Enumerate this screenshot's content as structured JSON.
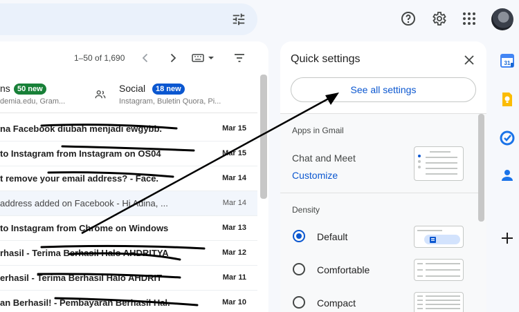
{
  "search": {
    "tune_icon": "tune-icon"
  },
  "header": {
    "help_icon": "help-icon",
    "settings_icon": "gear-icon",
    "apps_icon": "apps-grid-icon",
    "avatar": "avatar"
  },
  "toolbar": {
    "count": "1–50 of 1,690"
  },
  "tabs": [
    {
      "name": "Promotions",
      "label": "ns",
      "badge": "50 new",
      "badge_color": "#188038",
      "sub": "demia.edu, Gram..."
    },
    {
      "name": "Social",
      "label": "Social",
      "badge": "18 new",
      "badge_color": "#0b57d0",
      "sub": "Instagram, Buletin Quora, Pi..."
    }
  ],
  "emails": [
    {
      "text": "na Facebook diubah menjadi ewgybb.",
      "date": "Mar 15",
      "read": false
    },
    {
      "text": "to Instagram from Instagram on OS04",
      "date": "Mar 15",
      "read": false
    },
    {
      "text": "t remove your email address? - Face.",
      "date": "Mar 14",
      "read": false
    },
    {
      "text": "address added on Facebook - Hi Adina, ...",
      "date": "Mar 14",
      "read": true
    },
    {
      "text": "to Instagram from Chrome on Windows",
      "date": "Mar 13",
      "read": false
    },
    {
      "text": "rhasil - Terima Berhasil Halo AHDRITYA",
      "date": "Mar 12",
      "read": false
    },
    {
      "text": "erhasil - Terima Berhasil Halo AHDRIT",
      "date": "Mar 11",
      "read": false
    },
    {
      "text": "an Berhasil! - Pembayaran Berhasil Hal.",
      "date": "Mar 10",
      "read": false
    }
  ],
  "quick_settings": {
    "title": "Quick settings",
    "see_all": "See all settings",
    "apps_heading": "Apps in Gmail",
    "chat_meet": "Chat and Meet",
    "customize": "Customize",
    "density_heading": "Density",
    "density_options": [
      {
        "label": "Default",
        "selected": true
      },
      {
        "label": "Comfortable",
        "selected": false
      },
      {
        "label": "Compact",
        "selected": false
      }
    ]
  },
  "side_panel": [
    "calendar-icon",
    "keep-icon",
    "tasks-icon",
    "contacts-icon",
    "add-icon"
  ],
  "colors": {
    "accent": "#0b57d0",
    "bg": "#f6f8fc"
  }
}
